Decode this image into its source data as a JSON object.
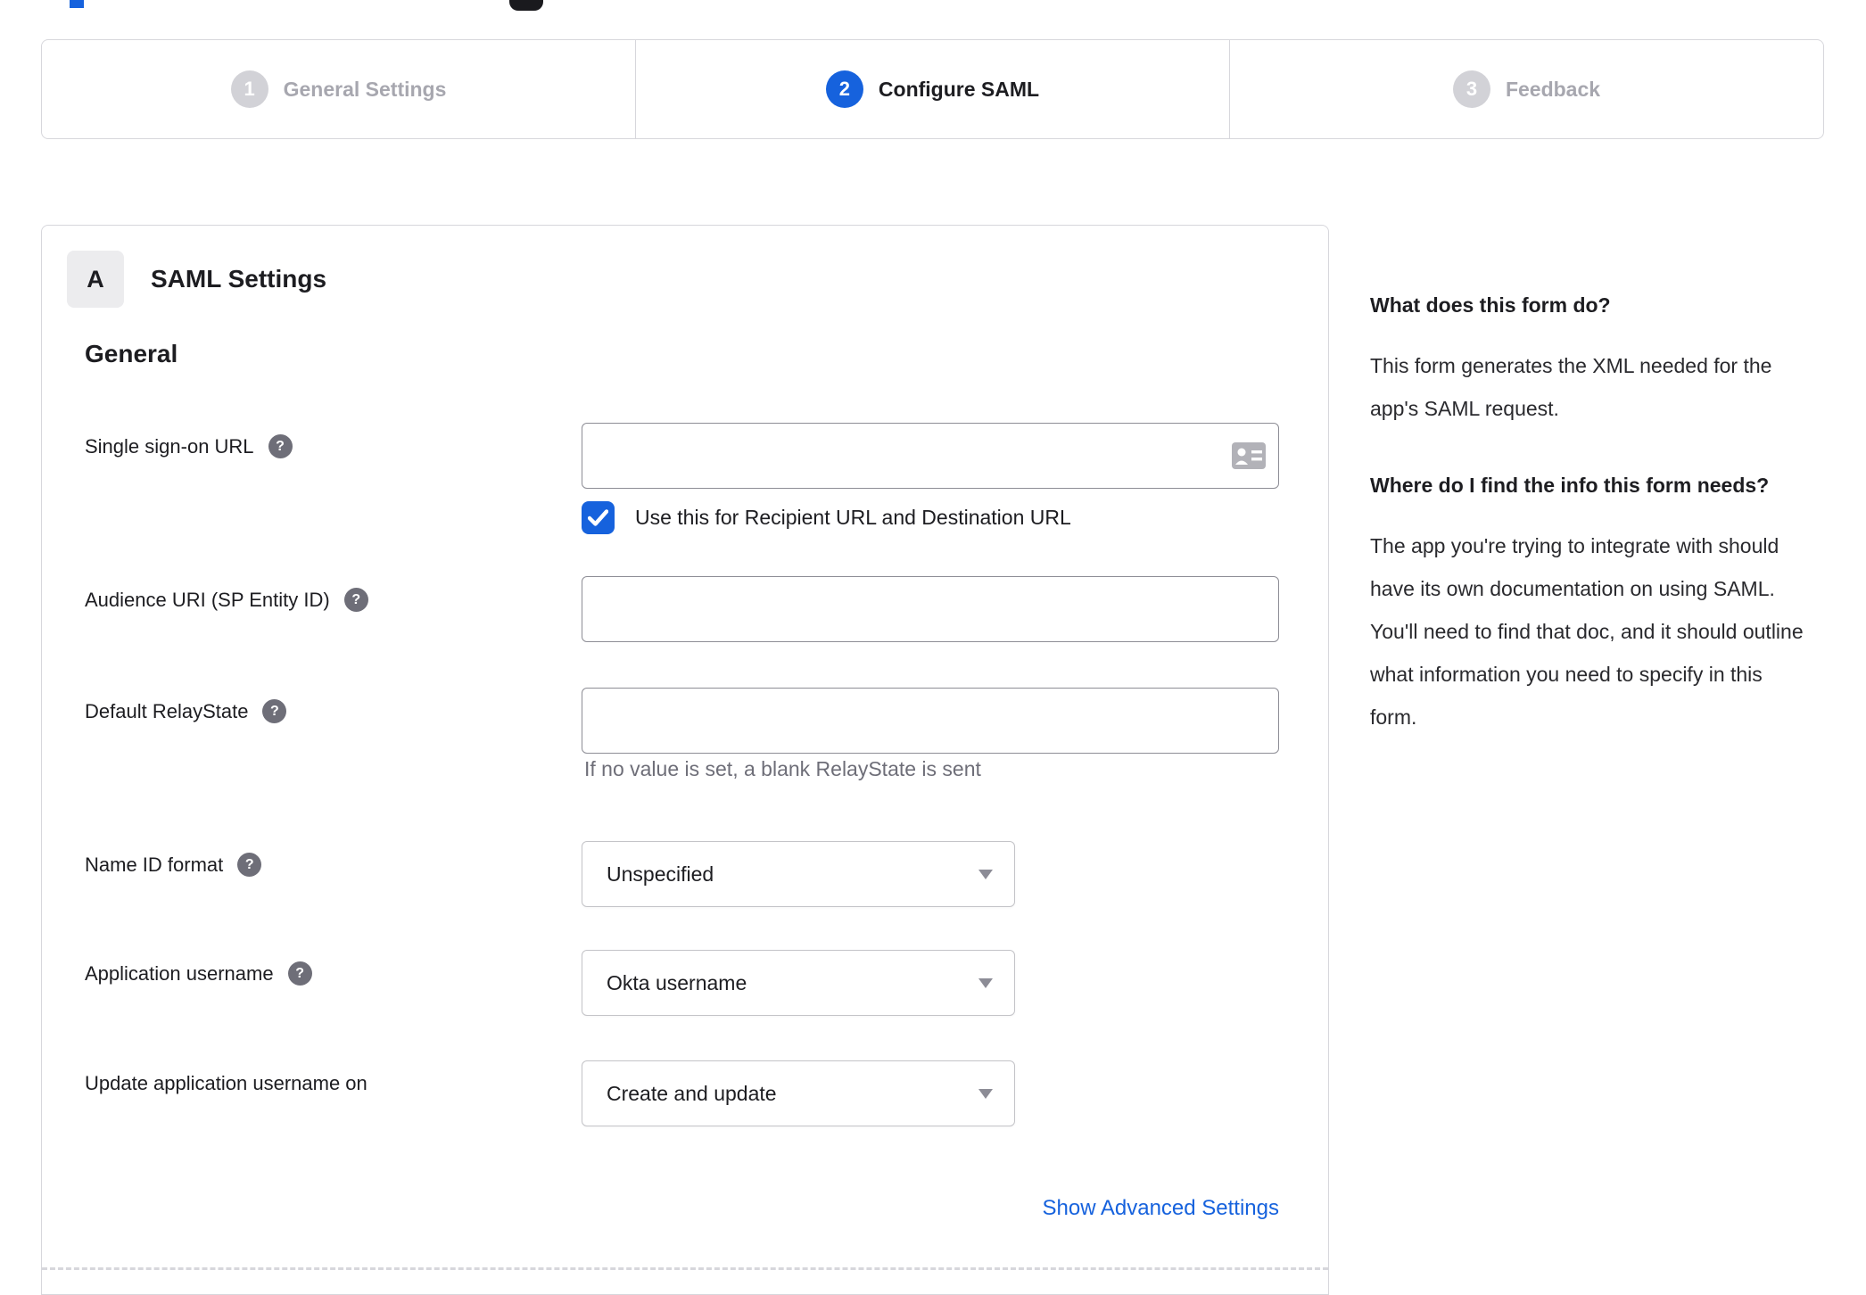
{
  "colors": {
    "accent": "#1662dd"
  },
  "stepper": {
    "steps": [
      {
        "number": "1",
        "label": "General Settings",
        "state": "inactive"
      },
      {
        "number": "2",
        "label": "Configure SAML",
        "state": "active"
      },
      {
        "number": "3",
        "label": "Feedback",
        "state": "inactive"
      }
    ]
  },
  "panel": {
    "section_badge": "A",
    "section_title": "SAML Settings",
    "group_title": "General",
    "fields": {
      "sso_url": {
        "label": "Single sign-on URL",
        "value": "",
        "checkbox_label": "Use this for Recipient URL and Destination URL",
        "checked": true
      },
      "audience_uri": {
        "label": "Audience URI (SP Entity ID)",
        "value": ""
      },
      "relay_state": {
        "label": "Default RelayState",
        "value": "",
        "hint": "If no value is set, a blank RelayState is sent"
      },
      "name_id": {
        "label": "Name ID format",
        "value": "Unspecified"
      },
      "app_username": {
        "label": "Application username",
        "value": "Okta username"
      },
      "update_username": {
        "label": "Update application username on",
        "value": "Create and update"
      }
    },
    "help_icon_glyph": "?",
    "advanced_link": "Show Advanced Settings"
  },
  "sidebar": {
    "sections": [
      {
        "heading": "What does this form do?",
        "body": "This form generates the XML needed for the app's SAML request."
      },
      {
        "heading": "Where do I find the info this form needs?",
        "body": "The app you're trying to integrate with should have its own documentation on using SAML. You'll need to find that doc, and it should outline what information you need to specify in this form."
      }
    ]
  }
}
